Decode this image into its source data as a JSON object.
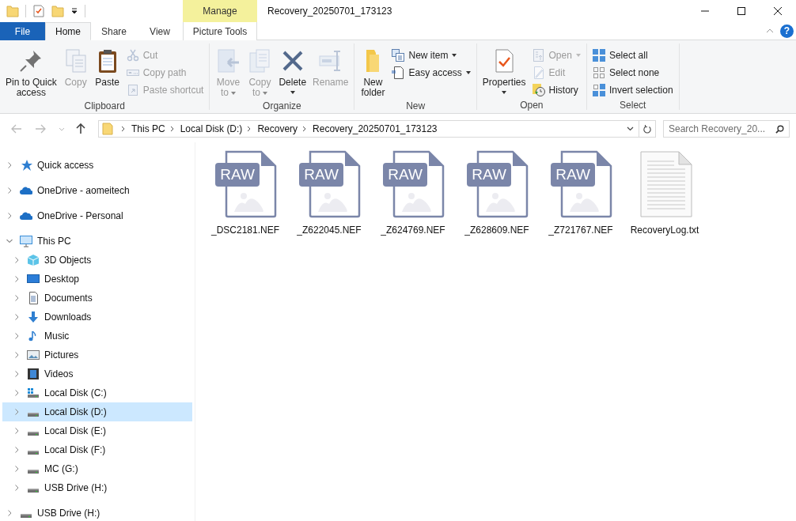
{
  "window": {
    "title": "Recovery_20250701_173123",
    "context_header": "Manage"
  },
  "tabs": [
    {
      "label": "File",
      "kind": "file",
      "selected": false
    },
    {
      "label": "Home",
      "kind": "normal",
      "selected": true
    },
    {
      "label": "Share",
      "kind": "normal",
      "selected": false
    },
    {
      "label": "View",
      "kind": "normal",
      "selected": false
    },
    {
      "label": "Picture Tools",
      "kind": "contextual",
      "selected": false
    }
  ],
  "help": "?",
  "ribbon": [
    {
      "label": "Clipboard",
      "large": [
        {
          "kind": "pin",
          "lines": [
            "Pin to Quick",
            "access"
          ],
          "disabled": false,
          "dropdown": false
        },
        {
          "kind": "copy",
          "lines": [
            "Copy"
          ],
          "disabled": true,
          "dropdown": false
        },
        {
          "kind": "paste",
          "lines": [
            "Paste"
          ],
          "disabled": false,
          "dropdown": false
        }
      ],
      "small": [
        {
          "kind": "cut",
          "label": "Cut",
          "disabled": true,
          "dropdown": false
        },
        {
          "kind": "copypath",
          "label": "Copy path",
          "disabled": true,
          "dropdown": false
        },
        {
          "kind": "pasteshortcut",
          "label": "Paste shortcut",
          "disabled": true,
          "dropdown": false
        }
      ]
    },
    {
      "label": "Organize",
      "large": [
        {
          "kind": "move",
          "lines": [
            "Move",
            "to"
          ],
          "disabled": true,
          "dropdown": true
        },
        {
          "kind": "copyto",
          "lines": [
            "Copy",
            "to"
          ],
          "disabled": true,
          "dropdown": true
        },
        {
          "kind": "delete",
          "lines": [
            "Delete"
          ],
          "disabled": false,
          "dropdown": true
        },
        {
          "kind": "rename",
          "lines": [
            "Rename"
          ],
          "disabled": true,
          "dropdown": false
        }
      ]
    },
    {
      "label": "New",
      "large": [
        {
          "kind": "newfolder",
          "lines": [
            "New",
            "folder"
          ],
          "disabled": false,
          "dropdown": false
        }
      ],
      "small": [
        {
          "kind": "newitem",
          "label": "New item",
          "disabled": false,
          "dropdown": true
        },
        {
          "kind": "easyaccess",
          "label": "Easy access",
          "disabled": false,
          "dropdown": true
        }
      ]
    },
    {
      "label": "Open",
      "large": [
        {
          "kind": "properties",
          "lines": [
            "Properties"
          ],
          "disabled": false,
          "dropdown": true
        }
      ],
      "small": [
        {
          "kind": "open",
          "label": "Open",
          "disabled": true,
          "dropdown": true
        },
        {
          "kind": "edit",
          "label": "Edit",
          "disabled": true,
          "dropdown": false
        },
        {
          "kind": "history",
          "label": "History",
          "disabled": false,
          "dropdown": false
        }
      ]
    },
    {
      "label": "Select",
      "small": [
        {
          "kind": "selectall",
          "label": "Select all",
          "disabled": false,
          "dropdown": false
        },
        {
          "kind": "selectnone",
          "label": "Select none",
          "disabled": false,
          "dropdown": false
        },
        {
          "kind": "invert",
          "label": "Invert selection",
          "disabled": false,
          "dropdown": false
        }
      ]
    }
  ],
  "address": {
    "crumbs": [
      "This PC",
      "Local Disk (D:)",
      "Recovery",
      "Recovery_20250701_173123"
    ]
  },
  "search": {
    "placeholder": "Search Recovery_20..."
  },
  "nav": [
    {
      "label": "Quick access",
      "kind": "star",
      "expanded": false,
      "selected": false
    },
    {
      "label": "OneDrive - aomeitech",
      "kind": "cloud",
      "expanded": false,
      "selected": false
    },
    {
      "label": "OneDrive - Personal",
      "kind": "cloud",
      "expanded": false,
      "selected": false
    },
    {
      "label": "This PC",
      "kind": "pc",
      "expanded": true,
      "selected": false,
      "children": [
        {
          "label": "3D Objects",
          "kind": "cube",
          "expanded": false,
          "selected": false
        },
        {
          "label": "Desktop",
          "kind": "desktop",
          "expanded": false,
          "selected": false
        },
        {
          "label": "Documents",
          "kind": "documents",
          "expanded": false,
          "selected": false
        },
        {
          "label": "Downloads",
          "kind": "downloads",
          "expanded": false,
          "selected": false
        },
        {
          "label": "Music",
          "kind": "music",
          "expanded": false,
          "selected": false
        },
        {
          "label": "Pictures",
          "kind": "pictures",
          "expanded": false,
          "selected": false
        },
        {
          "label": "Videos",
          "kind": "videos",
          "expanded": false,
          "selected": false
        },
        {
          "label": "Local Disk (C:)",
          "kind": "windisk",
          "expanded": false,
          "selected": false
        },
        {
          "label": "Local Disk (D:)",
          "kind": "disk",
          "expanded": false,
          "selected": true
        },
        {
          "label": "Local Disk (E:)",
          "kind": "disk",
          "expanded": false,
          "selected": false
        },
        {
          "label": "Local Disk (F:)",
          "kind": "disk",
          "expanded": false,
          "selected": false
        },
        {
          "label": "MC (G:)",
          "kind": "disk",
          "expanded": false,
          "selected": false
        },
        {
          "label": "USB Drive (H:)",
          "kind": "disk",
          "expanded": false,
          "selected": false
        }
      ]
    },
    {
      "label": "USB Drive (H:)",
      "kind": "disk",
      "expanded": false,
      "selected": false
    }
  ],
  "files": [
    {
      "name": "_DSC2181.NEF",
      "kind": "raw",
      "badge": "RAW"
    },
    {
      "name": "_Z622045.NEF",
      "kind": "raw",
      "badge": "RAW"
    },
    {
      "name": "_Z624769.NEF",
      "kind": "raw",
      "badge": "RAW"
    },
    {
      "name": "_Z628609.NEF",
      "kind": "raw",
      "badge": "RAW"
    },
    {
      "name": "_Z721767.NEF",
      "kind": "raw",
      "badge": "RAW"
    },
    {
      "name": "RecoveryLog.txt",
      "kind": "text"
    }
  ]
}
